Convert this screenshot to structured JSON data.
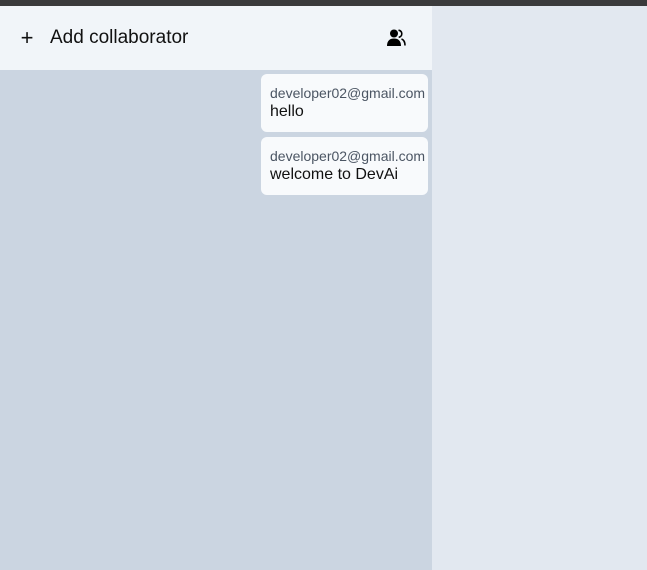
{
  "header": {
    "add_icon": "plus-icon",
    "add_label": "Add collaborator",
    "collaborators_icon": "users-icon"
  },
  "messages": [
    {
      "sender": "developer02@gmail.com",
      "text": "hello"
    },
    {
      "sender": "developer02@gmail.com",
      "text": "welcome to DevAi"
    }
  ],
  "colors": {
    "chat_background": "#cbd5e1",
    "header_background": "#f1f5f9",
    "side_background": "#e2e8f0",
    "bubble_background": "#f8fafc",
    "top_bar": "#3a3b3c"
  }
}
